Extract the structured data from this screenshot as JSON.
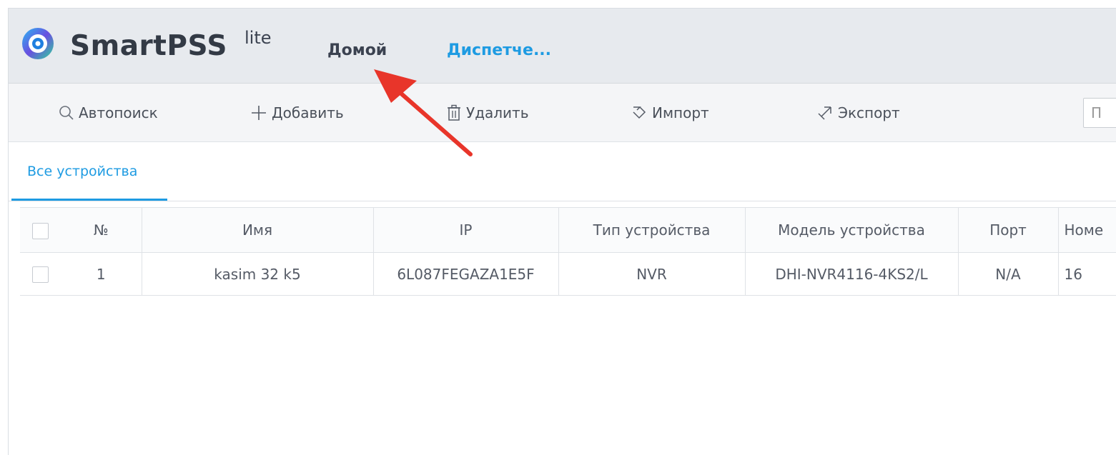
{
  "header": {
    "brand": "SmartPSS",
    "brand_sup": "lite",
    "nav": {
      "home": "Домой",
      "dispatcher": "Диспетче..."
    },
    "colors": {
      "background": "#e7eaee",
      "accent": "#1e9be2"
    }
  },
  "toolbar": {
    "autosearch": "Автопоиск",
    "add": "Добавить",
    "delete": "Удалить",
    "import": "Импорт",
    "export": "Экспорт",
    "search_placeholder": "П",
    "icons": {
      "autosearch": "search-icon",
      "add": "plus-icon",
      "delete": "trash-icon",
      "import": "import-icon",
      "export": "export-icon"
    }
  },
  "tabs": [
    {
      "label": "Все устройства",
      "active": true
    }
  ],
  "table": {
    "columns": {
      "no": "№",
      "name": "Имя",
      "ip": "IP",
      "type": "Тип устройства",
      "model": "Модель устройства",
      "port": "Порт",
      "number": "Номе"
    },
    "rows": [
      {
        "no": "1",
        "name": "kasim 32 k5",
        "ip": "6L087FEGAZA1E5F",
        "type": "NVR",
        "model": "DHI-NVR4116-4KS2/L",
        "port": "N/A",
        "number": "16"
      }
    ]
  },
  "annotation": {
    "arrow_color": "#e8352a"
  }
}
